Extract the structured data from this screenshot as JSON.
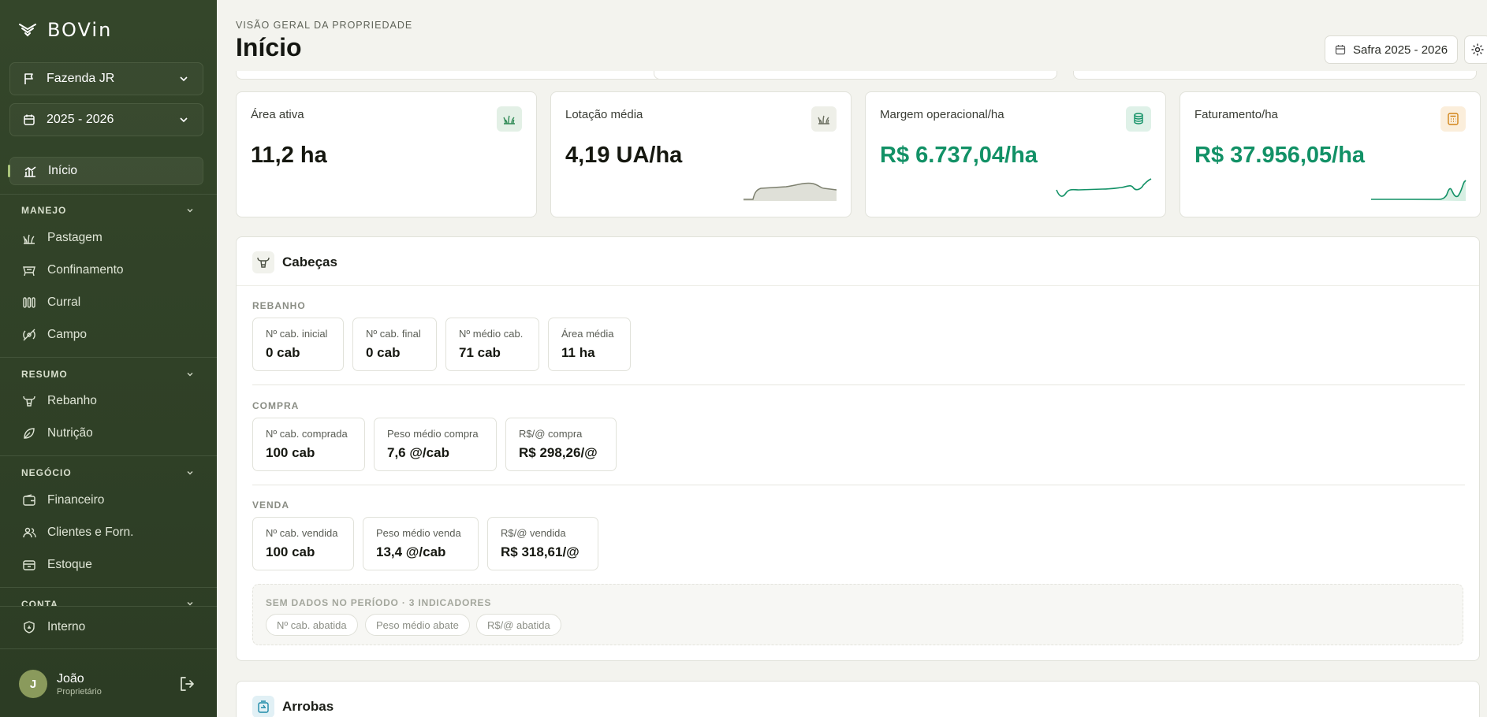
{
  "brand": {
    "name": "BOVin"
  },
  "sidebar": {
    "farm_selector": "Fazenda JR",
    "season_selector": "2025 - 2026",
    "home": "Início",
    "sections": [
      {
        "title": "MANEJO",
        "items": [
          "Pastagem",
          "Confinamento",
          "Curral",
          "Campo"
        ]
      },
      {
        "title": "RESUMO",
        "items": [
          "Rebanho",
          "Nutrição"
        ]
      },
      {
        "title": "NEGÓCIO",
        "items": [
          "Financeiro",
          "Clientes e Forn.",
          "Estoque"
        ]
      },
      {
        "title": "CONTA",
        "items": []
      }
    ],
    "internal": "Interno",
    "user": {
      "initial": "J",
      "name": "João",
      "role": "Proprietário"
    }
  },
  "header": {
    "eyebrow": "VISÃO GERAL DA PROPRIEDADE",
    "title": "Início",
    "season_button": "Safra 2025 - 2026"
  },
  "kpis": [
    {
      "label": "Área ativa",
      "value": "11,2 ha",
      "icon": "grass-icon",
      "accent": false
    },
    {
      "label": "Lotação média",
      "value": "4,19 UA/ha",
      "icon": "grass-icon",
      "accent": false
    },
    {
      "label": "Margem operacional/ha",
      "value": "R$ 6.737,04/ha",
      "icon": "coins-icon",
      "accent": true
    },
    {
      "label": "Faturamento/ha",
      "value": "R$ 37.956,05/ha",
      "icon": "calculator-icon",
      "accent": true
    }
  ],
  "cabecas": {
    "title": "Cabeças",
    "rebanho": {
      "label": "REBANHO",
      "metrics": [
        {
          "label": "Nº cab. inicial",
          "value": "0 cab"
        },
        {
          "label": "Nº cab. final",
          "value": "0 cab"
        },
        {
          "label": "Nº médio cab.",
          "value": "71 cab"
        },
        {
          "label": "Área média",
          "value": "11 ha"
        }
      ]
    },
    "compra": {
      "label": "COMPRA",
      "metrics": [
        {
          "label": "Nº cab. comprada",
          "value": "100 cab"
        },
        {
          "label": "Peso médio compra",
          "value": "7,6 @/cab"
        },
        {
          "label": "R$/@ compra",
          "value": "R$ 298,26/@"
        }
      ]
    },
    "venda": {
      "label": "VENDA",
      "metrics": [
        {
          "label": "Nº cab. vendida",
          "value": "100 cab"
        },
        {
          "label": "Peso médio venda",
          "value": "13,4 @/cab"
        },
        {
          "label": "R$/@ vendida",
          "value": "R$ 318,61/@"
        }
      ]
    },
    "no_data": {
      "title": "SEM DADOS NO PERÍODO · 3 INDICADORES",
      "chips": [
        "Nº cab. abatida",
        "Peso médio abate",
        "R$/@ abatida"
      ]
    }
  },
  "arrobas": {
    "title": "Arrobas"
  },
  "colors": {
    "sidebar_bg": "#34462a",
    "accent_green": "#129166",
    "page_bg": "#f3f3ee"
  }
}
